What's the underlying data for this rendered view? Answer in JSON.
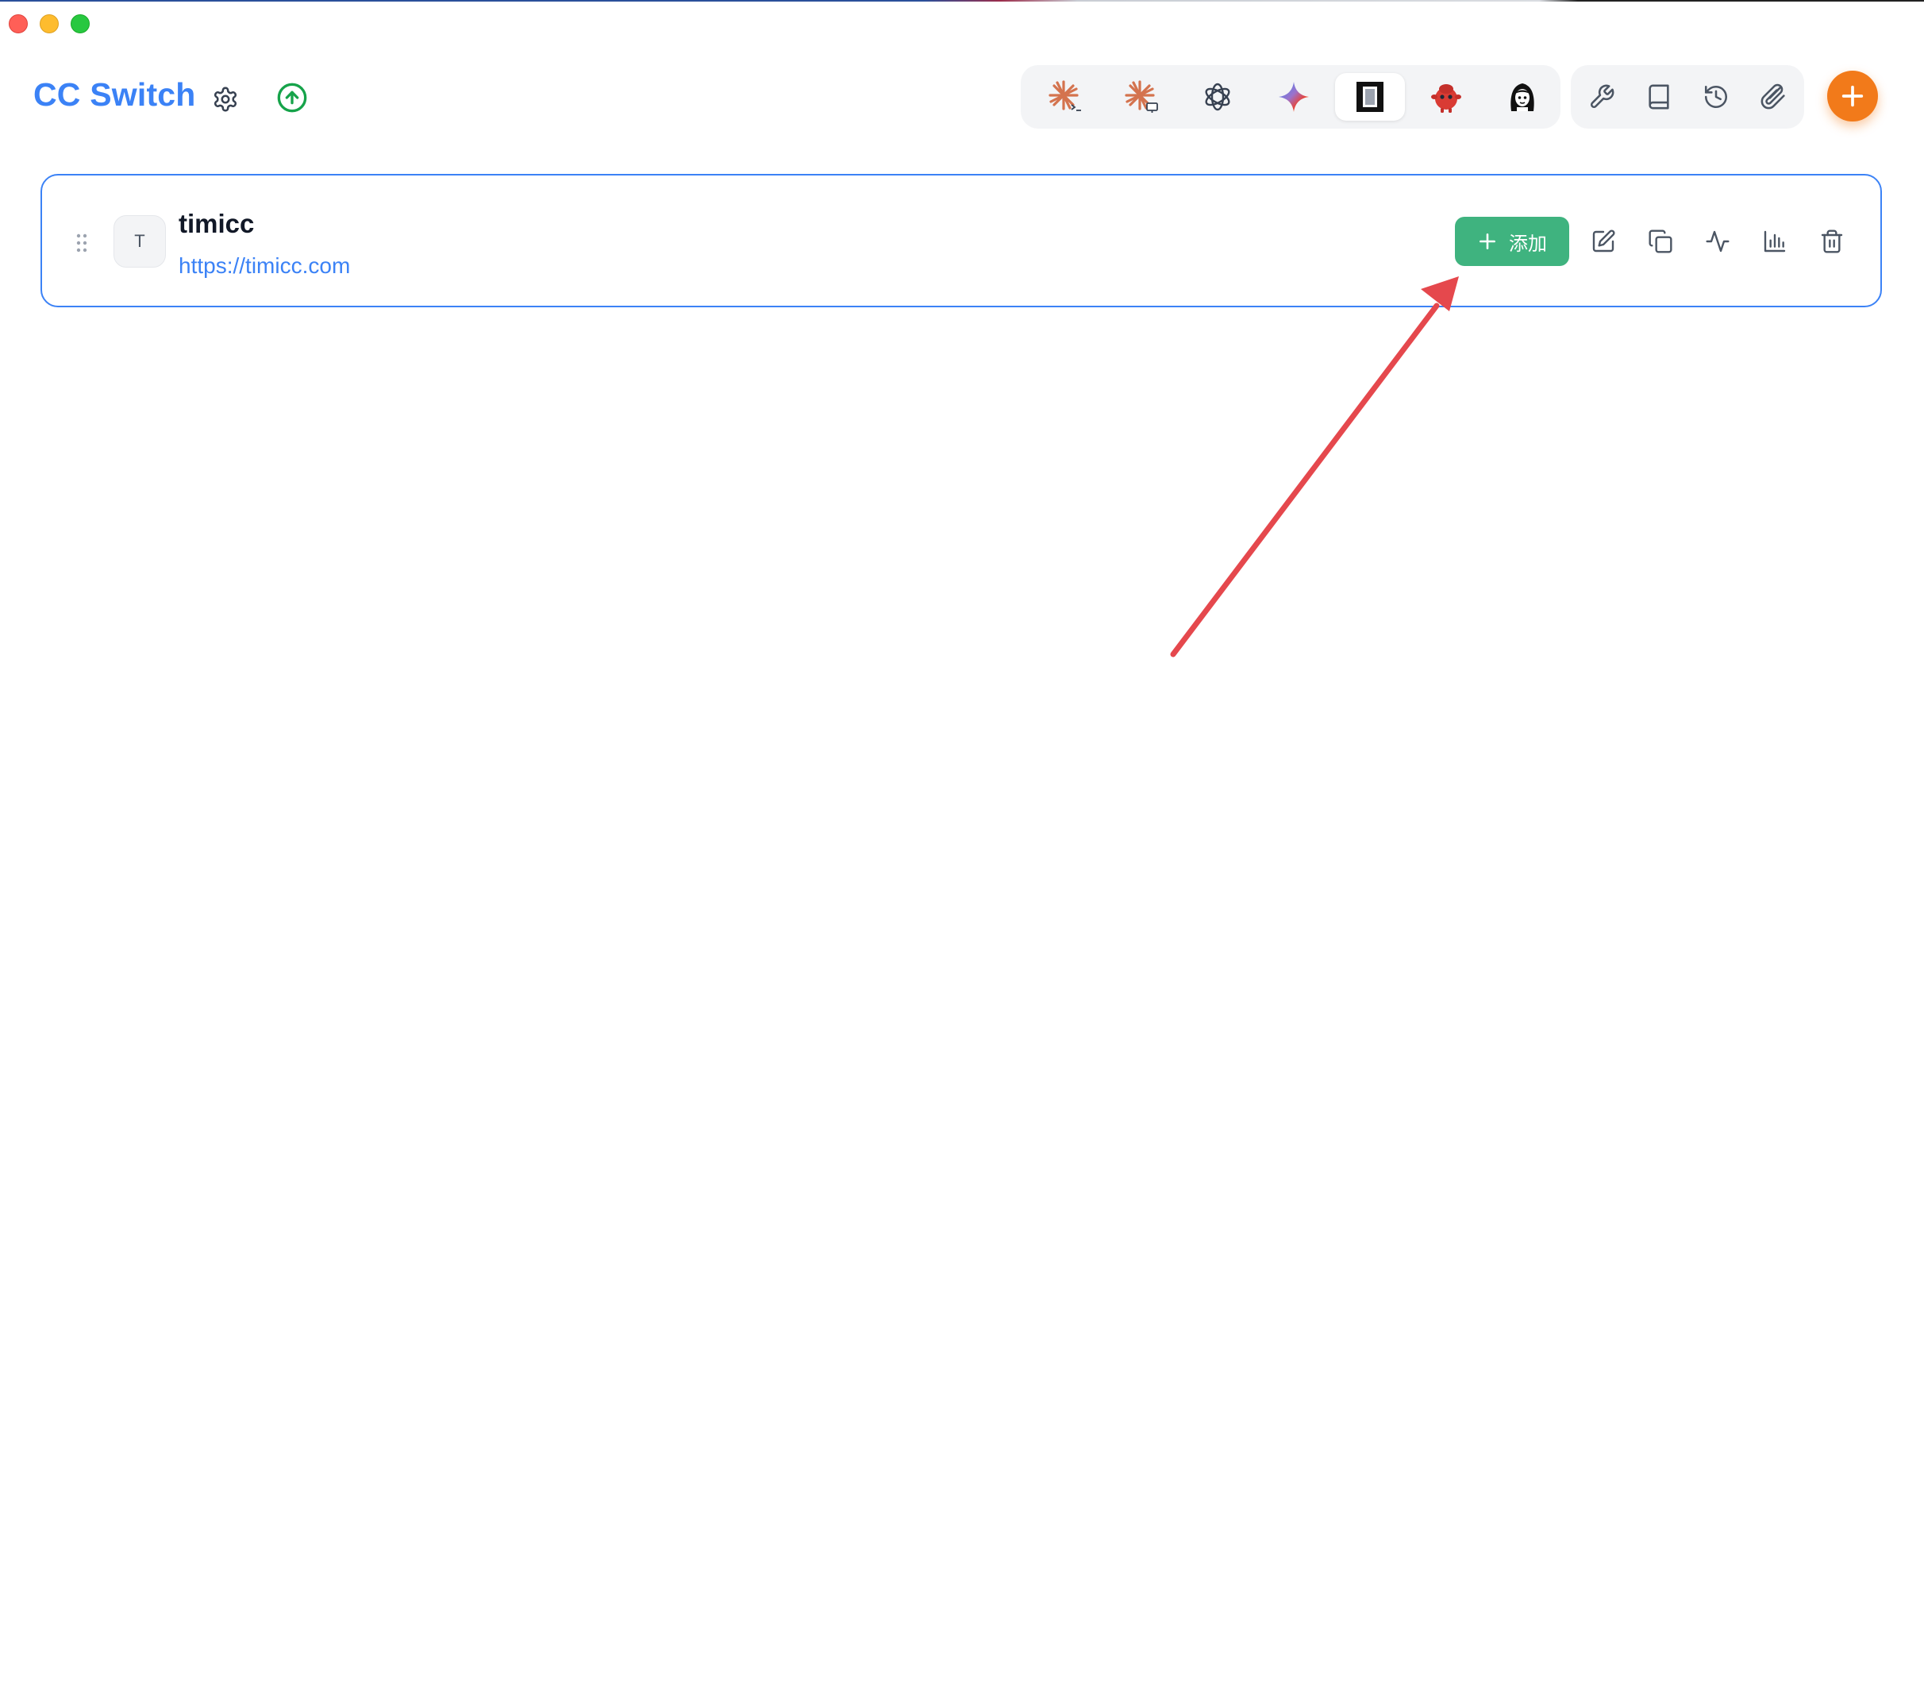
{
  "app": {
    "title": "CC Switch"
  },
  "header": {
    "settings_icon": "gear-icon",
    "update_icon": "arrow-up-circle-icon",
    "update_color": "#16a34a",
    "app_tabs": [
      {
        "name": "claude-code",
        "icon": "claude-code-icon",
        "active": false
      },
      {
        "name": "claude-desktop",
        "icon": "claude-desktop-icon",
        "active": false
      },
      {
        "name": "openai",
        "icon": "openai-icon",
        "active": false
      },
      {
        "name": "gemini",
        "icon": "gemini-icon",
        "active": false
      },
      {
        "name": "opencode",
        "icon": "opencode-icon",
        "active": true
      },
      {
        "name": "red-bot",
        "icon": "red-bot-icon",
        "active": false
      },
      {
        "name": "avatar-app",
        "icon": "avatar-app-icon",
        "active": false
      }
    ],
    "tools": [
      {
        "name": "tools",
        "icon": "wrench-icon"
      },
      {
        "name": "prompts",
        "icon": "book-icon"
      },
      {
        "name": "history",
        "icon": "history-icon"
      },
      {
        "name": "attachments",
        "icon": "paperclip-icon"
      }
    ],
    "add_icon": "plus-icon",
    "accent_color": "#3b82f6",
    "fab_color": "#f27a1a"
  },
  "providers": [
    {
      "avatar_letter": "T",
      "name": "timicc",
      "url": "https://timicc.com",
      "enable_label": "添加",
      "enable_color": "#3fb37f",
      "actions": [
        "edit-icon",
        "copy-icon",
        "activity-icon",
        "bar-chart-icon",
        "trash-icon"
      ]
    }
  ],
  "annotation": {
    "arrow_color": "#e5484d"
  }
}
